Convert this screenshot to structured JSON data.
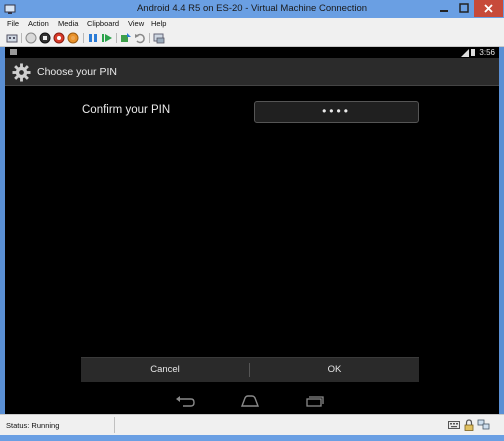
{
  "window": {
    "title": "Android 4.4 R5 on ES-20 - Virtual Machine Connection"
  },
  "menu": {
    "items": [
      "File",
      "Action",
      "Media",
      "Clipboard",
      "View",
      "Help"
    ]
  },
  "toolbar": {
    "icons": [
      "ctrl-alt-del-icon",
      "start-icon",
      "turn-off-icon",
      "shutdown-icon",
      "save-icon",
      "pause-icon",
      "reset-icon",
      "snapshot-icon",
      "revert-icon",
      "enhanced-session-icon"
    ]
  },
  "android": {
    "statusbar": {
      "time": "3:56"
    },
    "actionbar": {
      "title": "Choose your PIN"
    },
    "pin": {
      "label": "Confirm your PIN",
      "value": "••••"
    },
    "buttons": {
      "cancel": "Cancel",
      "ok": "OK"
    },
    "nav": [
      "back-icon",
      "home-icon",
      "recents-icon"
    ]
  },
  "vm_status": {
    "text": "Status: Running"
  },
  "colors": {
    "title_bar": "#6a9fe3",
    "close_button": "#c74a3a",
    "action_bar": "#2b2b2b",
    "button_bar": "#2a2a2a",
    "screen": "#000000"
  }
}
